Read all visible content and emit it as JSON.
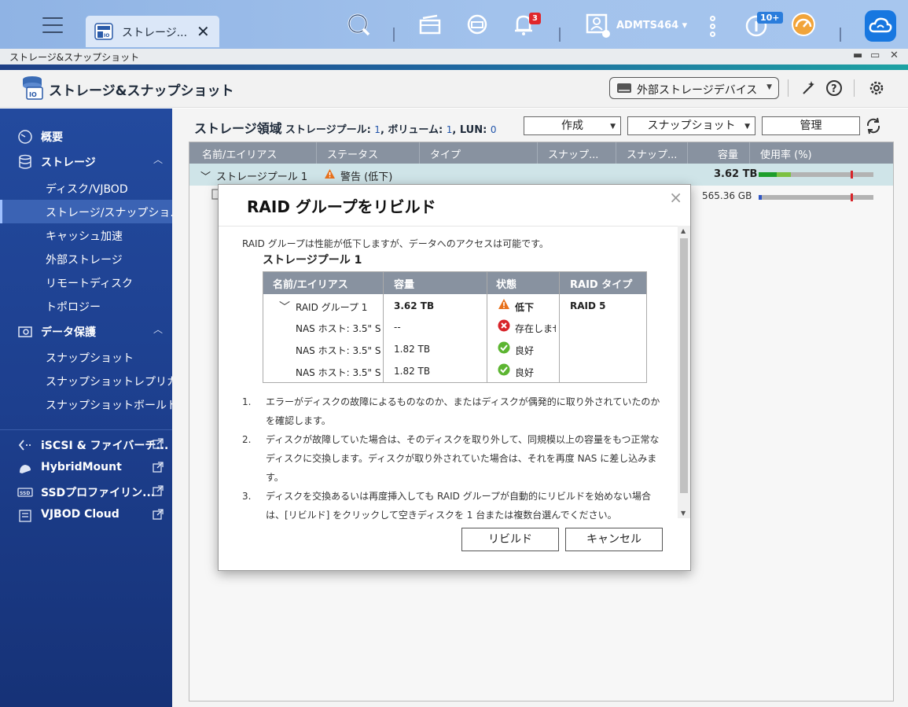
{
  "topbar": {
    "tab_label": "ストレージ...",
    "notification_count": "3",
    "username": "ADMTS464",
    "updates_count": "10+"
  },
  "window": {
    "title": "ストレージ&スナップショット",
    "minimize": "▬",
    "maximize": "▭",
    "close": "✕"
  },
  "app": {
    "title": "ストレージ&スナップショット",
    "external_devices": "外部ストレージデバイス"
  },
  "sidebar": {
    "overview": "概要",
    "storage": "ストレージ",
    "storage_items": [
      "ディスク/VJBOD",
      "ストレージ/スナップショ...",
      "キャッシュ加速",
      "外部ストレージ",
      "リモートディスク",
      "トポロジー"
    ],
    "data_protection": "データ保護",
    "protection_items": [
      "スナップショット",
      "スナップショットレプリカ",
      "スナップショットボールト"
    ],
    "external_apps": [
      "iSCSI & ファイバーチ...",
      "HybridMount",
      "SSDプロファイリン...",
      "VJBOD Cloud"
    ]
  },
  "main": {
    "heading": "ストレージ領域",
    "pool_label": "ストレージプール: ",
    "pool_count": "1",
    "volume_label": ", ボリューム: ",
    "volume_count": "1",
    "lun_label": ", LUN: ",
    "lun_count": "0",
    "create_button": "作成",
    "snapshot_button": "スナップショット",
    "manage_button": "管理",
    "columns": [
      "名前/エイリアス",
      "ステータス",
      "タイプ",
      "スナップ...",
      "スナップ...",
      "容量",
      "使用率 (%)"
    ],
    "pool_row": {
      "name": "ストレージプール 1",
      "status": "警告 (低下)",
      "capacity": "3.62 TB"
    },
    "volume_row": {
      "capacity": "565.36 GB"
    },
    "pool_usage": {
      "used_fraction": 0.16,
      "reserved_fraction": 0.12,
      "threshold": 0.8
    },
    "volume_usage": {
      "used_fraction": 0.03,
      "threshold": 0.8
    }
  },
  "modal": {
    "title": "RAID グループをリビルド",
    "close": "×",
    "intro": "RAID グループは性能が低下しますが、データへのアクセスは可能です。",
    "pool_name": "ストレージプール 1",
    "table_headers": [
      "名前/エイリアス",
      "容量",
      "状態",
      "RAID タイプ"
    ],
    "group_row": {
      "name": "RAID グループ 1",
      "capacity": "3.62 TB",
      "status": "低下",
      "raid_type": "RAID 5"
    },
    "disks": [
      {
        "name": "NAS ホスト: 3.5\" S...",
        "capacity": "--",
        "status": "存在しません"
      },
      {
        "name": "NAS ホスト: 3.5\" S...",
        "capacity": "1.82 TB",
        "status": "良好"
      },
      {
        "name": "NAS ホスト: 3.5\" S...",
        "capacity": "1.82 TB",
        "status": "良好"
      }
    ],
    "steps": [
      {
        "num": "1.",
        "text": "エラーがディスクの故障によるものなのか、またはディスクが偶発的に取り外されていたのかを確認します。"
      },
      {
        "num": "2.",
        "text": "ディスクが故障していた場合は、そのディスクを取り外して、同規模以上の容量をもつ正常なディスクに交換します。ディスクが取り外されていた場合は、それを再度 NAS に差し込みます。"
      },
      {
        "num": "3.",
        "text": "ディスクを交換あるいは再度挿入しても RAID グループが自動的にリビルドを始めない場合は、[リビルド] をクリックして空きディスクを 1 台または複数台選んでください。"
      }
    ],
    "rebuild_button": "リビルド",
    "cancel_button": "キャンセル"
  },
  "colors": {
    "sidebar_bg": "#1d3f8e",
    "accent": "#1777e0",
    "warning": "#e8711c",
    "error": "#d8242a",
    "ok": "#5cb531"
  }
}
